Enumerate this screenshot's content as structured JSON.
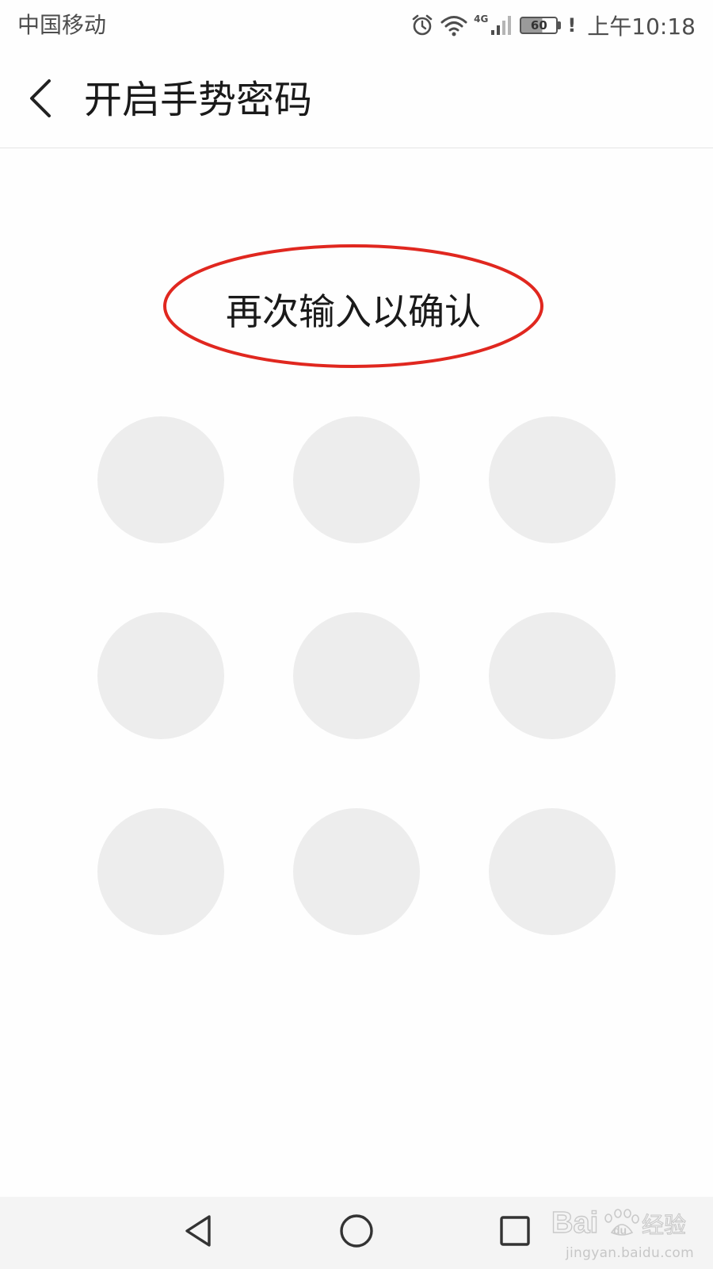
{
  "status_bar": {
    "carrier": "中国移动",
    "network_type": "4G",
    "battery_level": "60",
    "battery_fraction": 0.6,
    "alert": "!",
    "time": "上午10:18",
    "icons": [
      "alarm-icon",
      "wifi-icon",
      "signal-icon",
      "battery-icon"
    ]
  },
  "header": {
    "title": "开启手势密码",
    "back_icon": "chevron-left-icon"
  },
  "gesture": {
    "hint": "再次输入以确认",
    "hint_highlight_color": "#e0271f",
    "dot_color": "#ededed",
    "dots": [
      "1",
      "2",
      "3",
      "4",
      "5",
      "6",
      "7",
      "8",
      "9"
    ]
  },
  "nav_bar": {
    "back_icon": "triangle-back-icon",
    "home_icon": "circle-home-icon",
    "recents_icon": "square-recents-icon"
  },
  "watermark": {
    "brand": "Bai",
    "brand2": "du",
    "label": "经验",
    "url": "jingyan.baidu.com"
  }
}
